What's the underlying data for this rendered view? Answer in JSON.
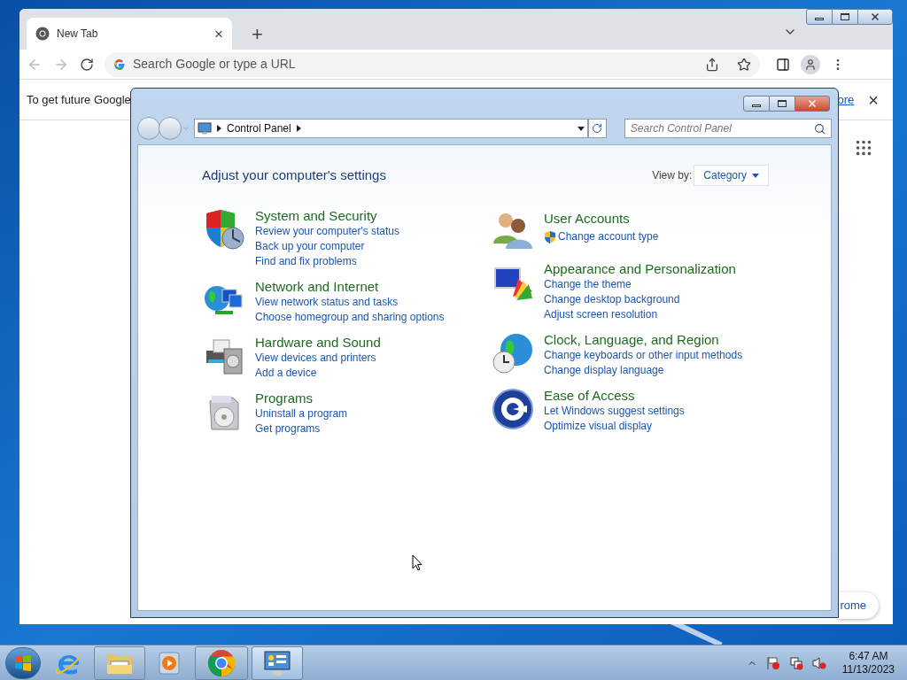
{
  "browser": {
    "tab": {
      "title": "New Tab",
      "close": "×"
    },
    "new_tab": "+",
    "omnibox": {
      "placeholder": "Search Google or type a URL"
    },
    "infobar": {
      "text": "To get future Google",
      "link": "ore",
      "close": "×"
    },
    "bottom_button": "rome"
  },
  "control_panel": {
    "breadcrumb": [
      "Control Panel"
    ],
    "search": {
      "placeholder": "Search Control Panel"
    },
    "heading": "Adjust your computer's settings",
    "view_by": {
      "label": "View by:",
      "value": "Category"
    },
    "columns": [
      [
        {
          "title": "System and Security",
          "links": [
            {
              "text": "Review your computer's status",
              "kind": "plain"
            },
            {
              "text": "Back up your computer",
              "kind": "plain"
            },
            {
              "text": "Find and fix problems",
              "kind": "plain"
            }
          ]
        },
        {
          "title": "Network and Internet",
          "links": [
            {
              "text": "View network status and tasks",
              "kind": "plain"
            },
            {
              "text": "Choose homegroup and sharing options",
              "kind": "plain"
            }
          ]
        },
        {
          "title": "Hardware and Sound",
          "links": [
            {
              "text": "View devices and printers",
              "kind": "plain"
            },
            {
              "text": "Add a device",
              "kind": "plain"
            }
          ]
        },
        {
          "title": "Programs",
          "links": [
            {
              "text": "Uninstall a program",
              "kind": "plain"
            },
            {
              "text": "Get programs",
              "kind": "plain"
            }
          ]
        }
      ],
      [
        {
          "title": "User Accounts",
          "links": [
            {
              "text": "Change account type",
              "kind": "admin"
            }
          ]
        },
        {
          "title": "Appearance and Personalization",
          "links": [
            {
              "text": "Change the theme",
              "kind": "plain"
            },
            {
              "text": "Change desktop background",
              "kind": "plain"
            },
            {
              "text": "Adjust screen resolution",
              "kind": "plain"
            }
          ]
        },
        {
          "title": "Clock, Language, and Region",
          "links": [
            {
              "text": "Change keyboards or other input methods",
              "kind": "plain"
            },
            {
              "text": "Change display language",
              "kind": "plain"
            }
          ]
        },
        {
          "title": "Ease of Access",
          "links": [
            {
              "text": "Let Windows suggest settings",
              "kind": "plain"
            },
            {
              "text": "Optimize visual display",
              "kind": "plain"
            }
          ]
        }
      ]
    ]
  },
  "taskbar": {
    "apps": [
      {
        "running": false,
        "selected": false
      },
      {
        "running": true,
        "selected": false
      },
      {
        "running": false,
        "selected": false
      },
      {
        "running": true,
        "selected": false
      },
      {
        "running": true,
        "selected": true
      }
    ],
    "time": "6:47 AM",
    "date": "11/13/2023"
  }
}
